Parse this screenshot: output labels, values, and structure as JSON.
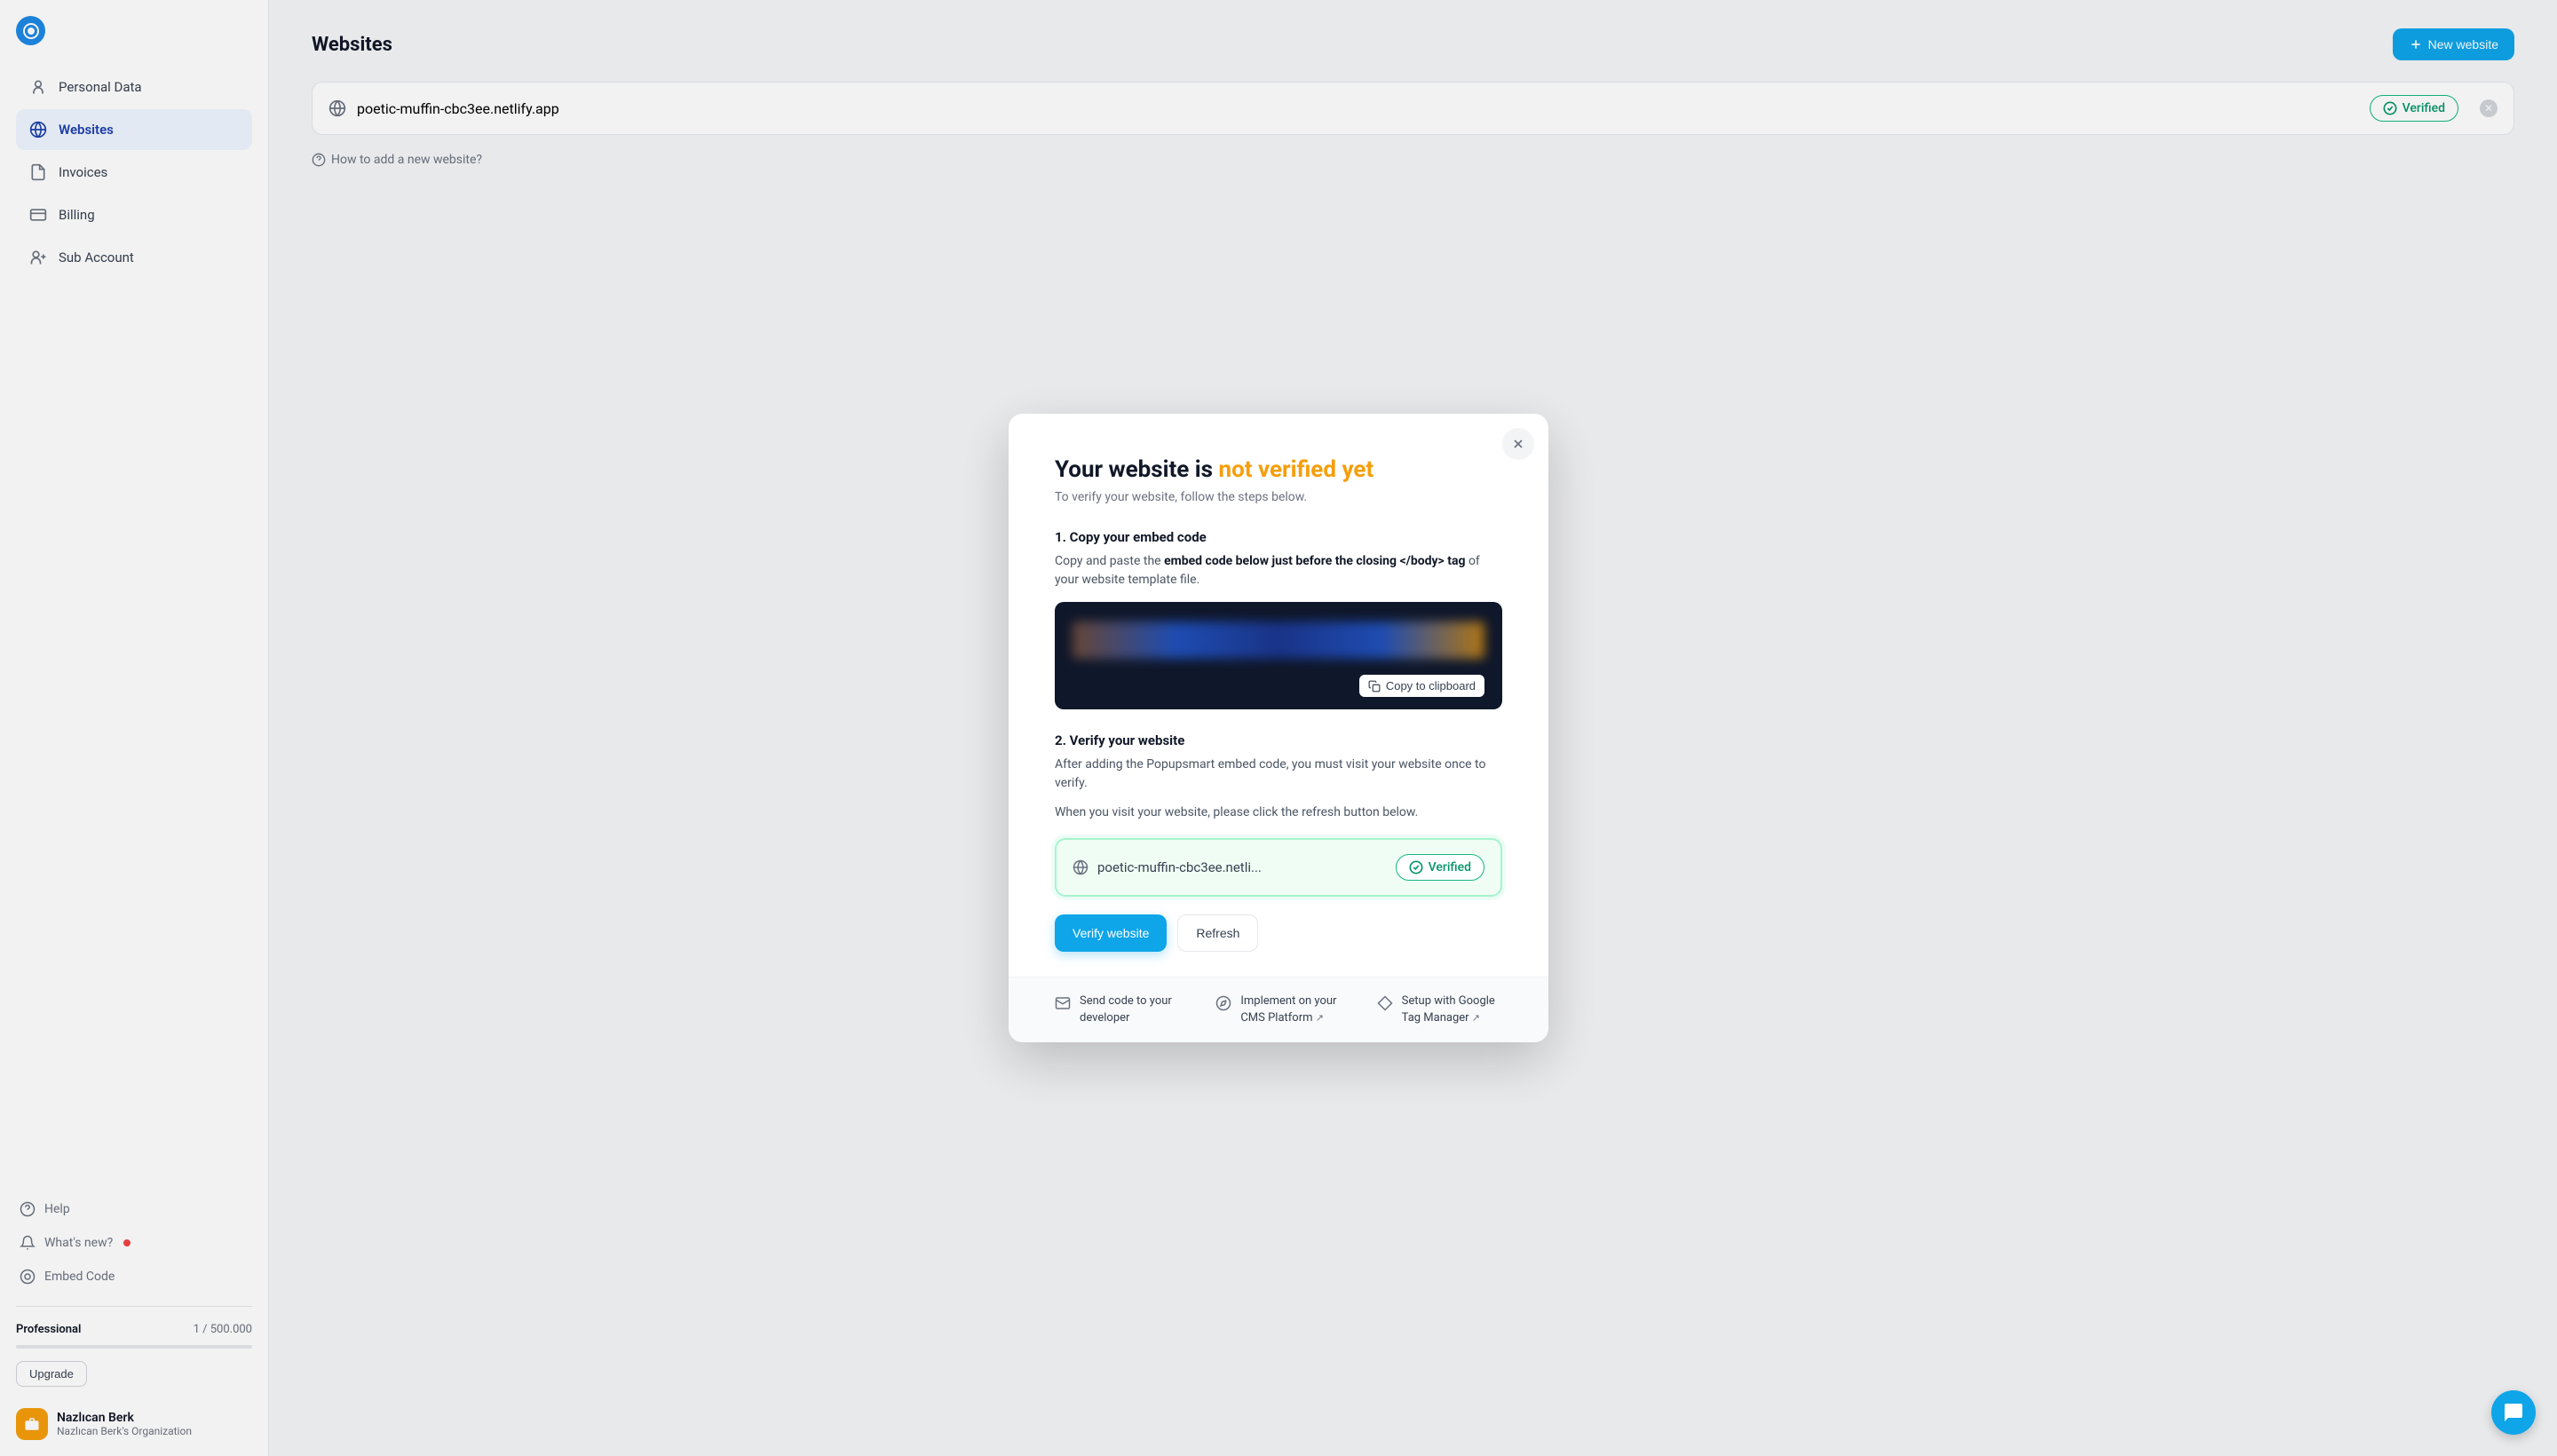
{
  "sidebar": {
    "nav": [
      {
        "label": "Personal Data"
      },
      {
        "label": "Websites"
      },
      {
        "label": "Invoices"
      },
      {
        "label": "Billing"
      },
      {
        "label": "Sub Account"
      }
    ],
    "secondary": {
      "help": "Help",
      "whatsnew": "What's new?",
      "embed": "Embed Code"
    },
    "plan": {
      "name": "Professional",
      "usage": "1 / 500.000",
      "upgrade": "Upgrade"
    },
    "user": {
      "name": "Nazlıcan Berk",
      "org": "Nazlıcan Berk's Organization"
    }
  },
  "main": {
    "title": "Websites",
    "new_button": "New website",
    "website_url": "poetic-muffin-cbc3ee.netlify.app",
    "verified": "Verified",
    "help_link": "How to add a new website?"
  },
  "modal": {
    "title_a": "Your website is ",
    "title_b": "not verified yet",
    "subtitle": "To verify your website, follow the steps below.",
    "step1_title": "1. Copy your embed code",
    "step1_desc_a": "Copy and paste the ",
    "step1_desc_b": "embed code below just before the closing </body> tag",
    "step1_desc_c": " of your website template file.",
    "copy_btn": "Copy to clipboard",
    "step2_title": "2. Verify your website",
    "step2_desc1": "After adding the Popupsmart embed code, you must visit your website once to verify.",
    "step2_desc2": "When you visit your website, please click the refresh button below.",
    "verify_url": "poetic-muffin-cbc3ee.netli...",
    "verified": "Verified",
    "verify_btn": "Verify website",
    "refresh_btn": "Refresh",
    "footer": {
      "send": "Send code to your developer",
      "cms": "Implement on your CMS Platform",
      "gtm": "Setup with Google Tag Manager"
    }
  }
}
